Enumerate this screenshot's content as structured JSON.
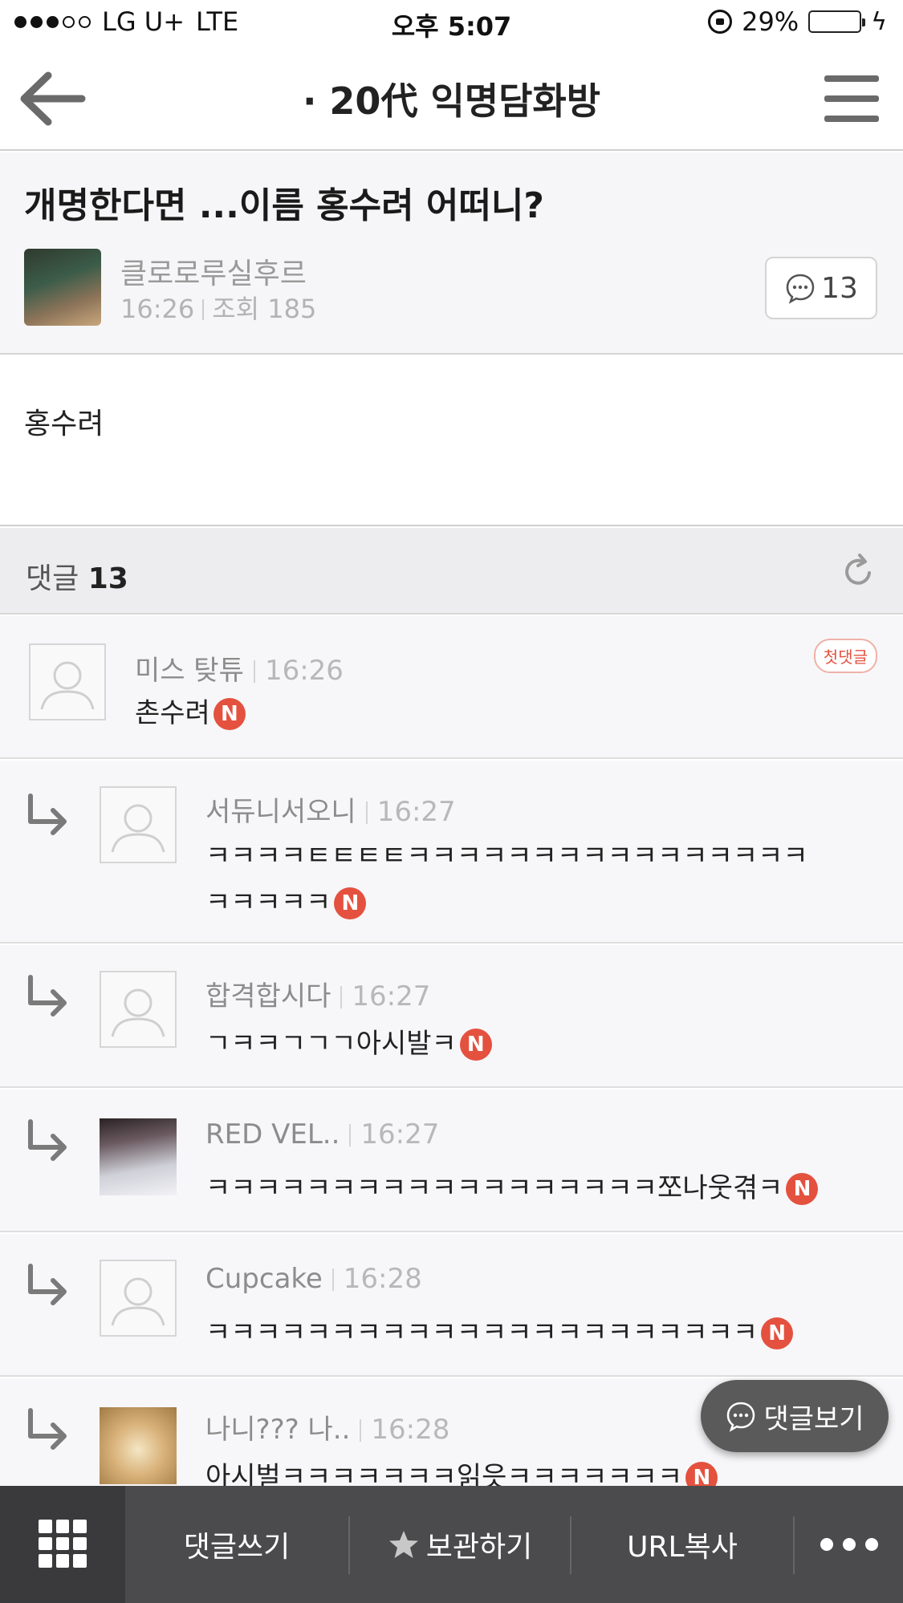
{
  "status_bar": {
    "carrier": "LG U+",
    "network": "LTE",
    "time": "오후 5:07",
    "battery_percent": "29%",
    "battery_level": 0.29
  },
  "nav": {
    "title": "· 20代 익명담화방",
    "back_icon": "arrow-left-icon",
    "menu_icon": "hamburger-menu-icon"
  },
  "post": {
    "title": "개명한다면 ...이름 홍수려 어떠니?",
    "author": "클로로루실후르",
    "time": "16:26",
    "views_label": "조회 185",
    "comment_count": "13",
    "body": "홍수려"
  },
  "comments_header": {
    "label": "댓글",
    "count": "13"
  },
  "comments": [
    {
      "author": "미스 탖튜",
      "time": "16:26",
      "text": "촌수려",
      "badge": "N",
      "first_badge": "첫댓글",
      "reply": false
    },
    {
      "author": "서듀니서오니",
      "time": "16:27",
      "text_line1": "ㅋㅋㅋㅋㅌㅌㅌㅌㅋㅋㅋㅋㅋㅋㅋㅋㅋㅋㅋㅋㅋㅋㅋㅋ",
      "text_line2": "ㅋㅋㅋㅋㅋ",
      "badge": "N",
      "reply": true
    },
    {
      "author": "합격합시다",
      "time": "16:27",
      "text": "ㄱㅋㅋㄱㄱㄱ아시발ㅋ",
      "badge": "N",
      "reply": true
    },
    {
      "author": "RED VEL..",
      "time": "16:27",
      "text": "ㅋㅋㅋㅋㅋㅋㅋㅋㅋㅋㅋㅋㅋㅋㅋㅋㅋㅋ쪼나웃겪ㅋ",
      "badge": "N",
      "reply": true
    },
    {
      "author": "Cupcake",
      "time": "16:28",
      "text": "ㅋㅋㅋㅋㅋㅋㅋㅋㅋㅋㅋㅋㅋㅋㅋㅋㅋㅋㅋㅋㅋㅋ",
      "badge": "N",
      "reply": true
    },
    {
      "author": "나니??? 나..",
      "time": "16:28",
      "text": "아시벌ㅋㅋㅋㅋㅋㅋㅋ읽읏ㅋㅋㅋㅋㅋㅋㅋ",
      "badge": "N",
      "reply": true
    }
  ],
  "floating_button": {
    "label": "댓글보기"
  },
  "toolbar": {
    "write_comment": "댓글쓰기",
    "bookmark": "보관하기",
    "copy_url": "URL복사"
  },
  "colors": {
    "accent_red": "#e4513f",
    "toolbar_bg": "#4b4b4d",
    "battery_green": "#4cd964"
  }
}
